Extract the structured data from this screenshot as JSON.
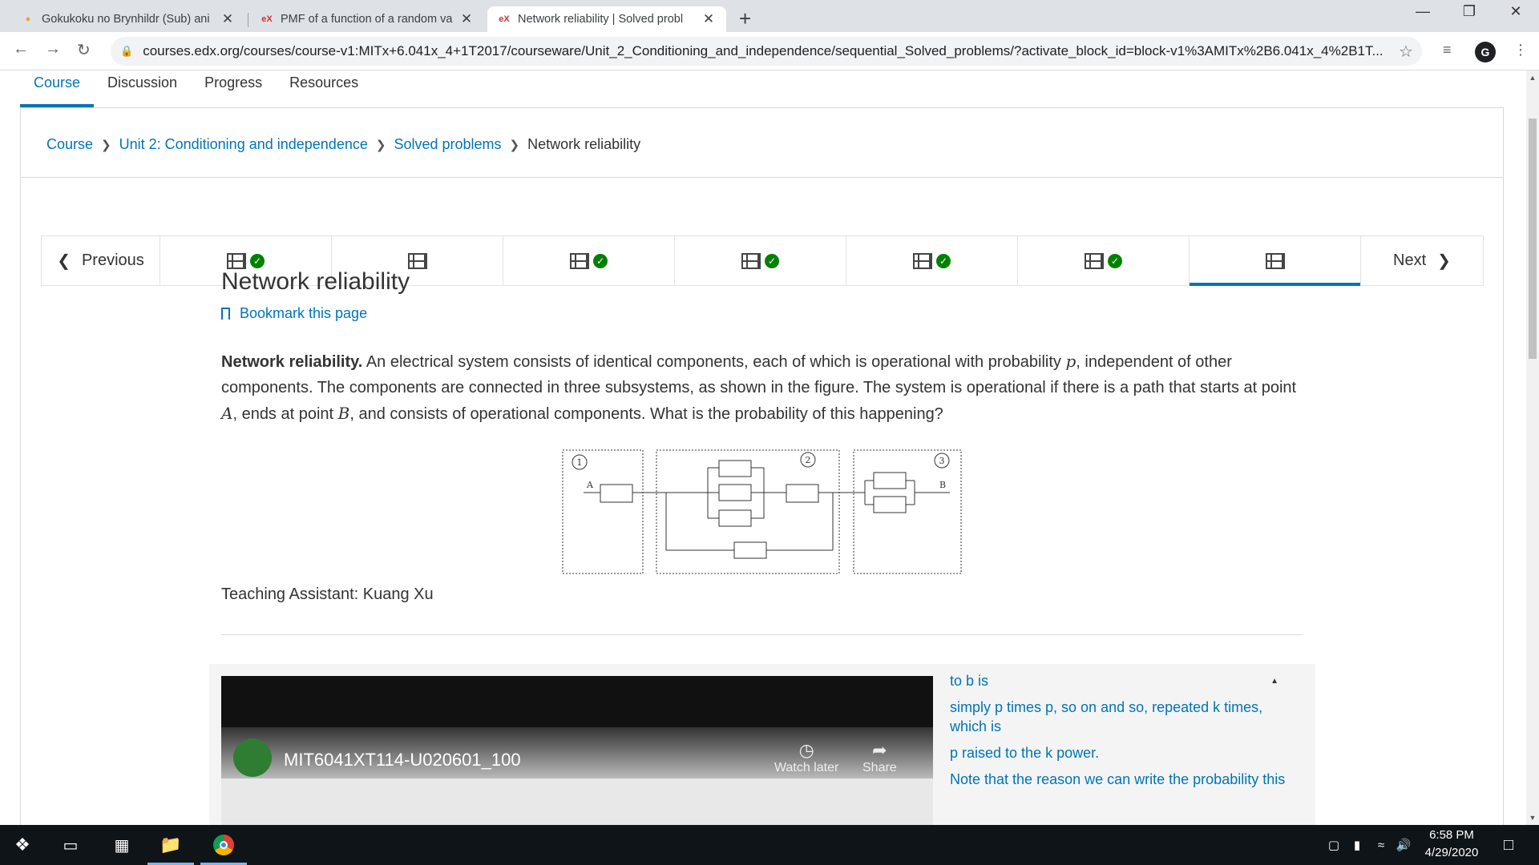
{
  "browser": {
    "tabs": [
      {
        "title": "Gokukoku no Brynhildr (Sub) ani",
        "favicon": "gogoanime-icon",
        "active": false
      },
      {
        "title": "PMF of a function of a random va",
        "favicon": "edx-icon",
        "active": false
      },
      {
        "title": "Network reliability | Solved probl",
        "favicon": "edx-icon",
        "active": true
      }
    ],
    "url": "courses.edx.org/courses/course-v1:MITx+6.041x_4+1T2017/courseware/Unit_2_Conditioning_and_independence/sequential_Solved_problems/?activate_block_id=block-v1%3AMITx%2B6.041x_4%2B1T...",
    "profile_letter": "G"
  },
  "course_nav": [
    "Course",
    "Discussion",
    "Progress",
    "Resources"
  ],
  "breadcrumb": {
    "items": [
      "Course",
      "Unit 2: Conditioning and independence",
      "Solved problems"
    ],
    "current": "Network reliability"
  },
  "sequence": {
    "previous": "Previous",
    "next": "Next",
    "units": [
      {
        "completed": true
      },
      {
        "completed": false
      },
      {
        "completed": true
      },
      {
        "completed": true
      },
      {
        "completed": true
      },
      {
        "completed": true
      },
      {
        "completed": false,
        "active": true
      }
    ]
  },
  "content": {
    "title": "Network reliability",
    "bookmark": "Bookmark this page",
    "problem_bold": "Network reliability.",
    "problem_text_1": " An electrical system consists of identical components, each of which is operational with probability ",
    "problem_var_p": "p",
    "problem_text_2": ", independent of other components. The components are connected in three subsystems, as shown in the figure. The system is operational if there is a path that starts at point ",
    "problem_var_a": "A",
    "problem_text_3": ", ends at point ",
    "problem_var_b": "B",
    "problem_text_4": ", and consists of operational components. What is the probability of this happening?",
    "figure": {
      "labels": [
        "1",
        "2",
        "3"
      ],
      "point_a": "A",
      "point_b": "B"
    },
    "ta": "Teaching Assistant: Kuang Xu"
  },
  "video": {
    "title": "MIT6041XT114-U020601_100",
    "watch_later": "Watch later",
    "share": "Share",
    "transcript": [
      "to b is",
      "simply p times p, so on and so, repeated k times, which is",
      "p raised to the k power.",
      "Note that the reason we can write the probability this"
    ]
  },
  "taskbar": {
    "time": "6:58 PM",
    "date": "4/29/2020"
  }
}
